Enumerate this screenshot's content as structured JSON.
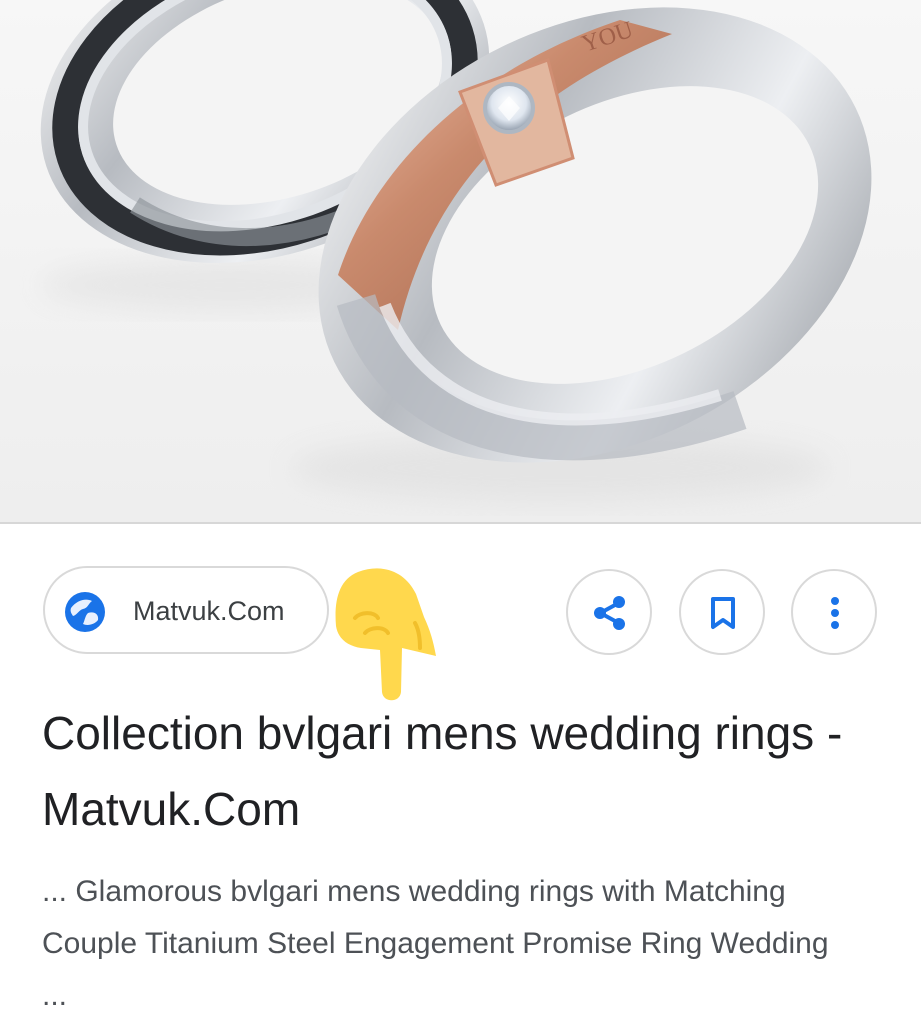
{
  "result": {
    "image_alt": "Silver and rose gold couple titanium rings",
    "source_label": "Matvuk.Com",
    "title": "Collection bvlgari mens wedding rings - Matvuk.Com",
    "snippet": "... Glamorous bvlgari mens wedding rings with Matching Couple Titanium Steel Engagement Promise Ring Wedding ..."
  },
  "icons": {
    "source": "globe-icon",
    "share": "share-icon",
    "save": "bookmark-icon",
    "more": "more-vertical-icon",
    "annotation": "pointing-hand-icon"
  },
  "colors": {
    "accent_blue": "#1a73e8",
    "pointer_yellow": "#ffd84d",
    "ring_rose": "#d39a7f",
    "ring_silver": "#c8cbd0"
  }
}
